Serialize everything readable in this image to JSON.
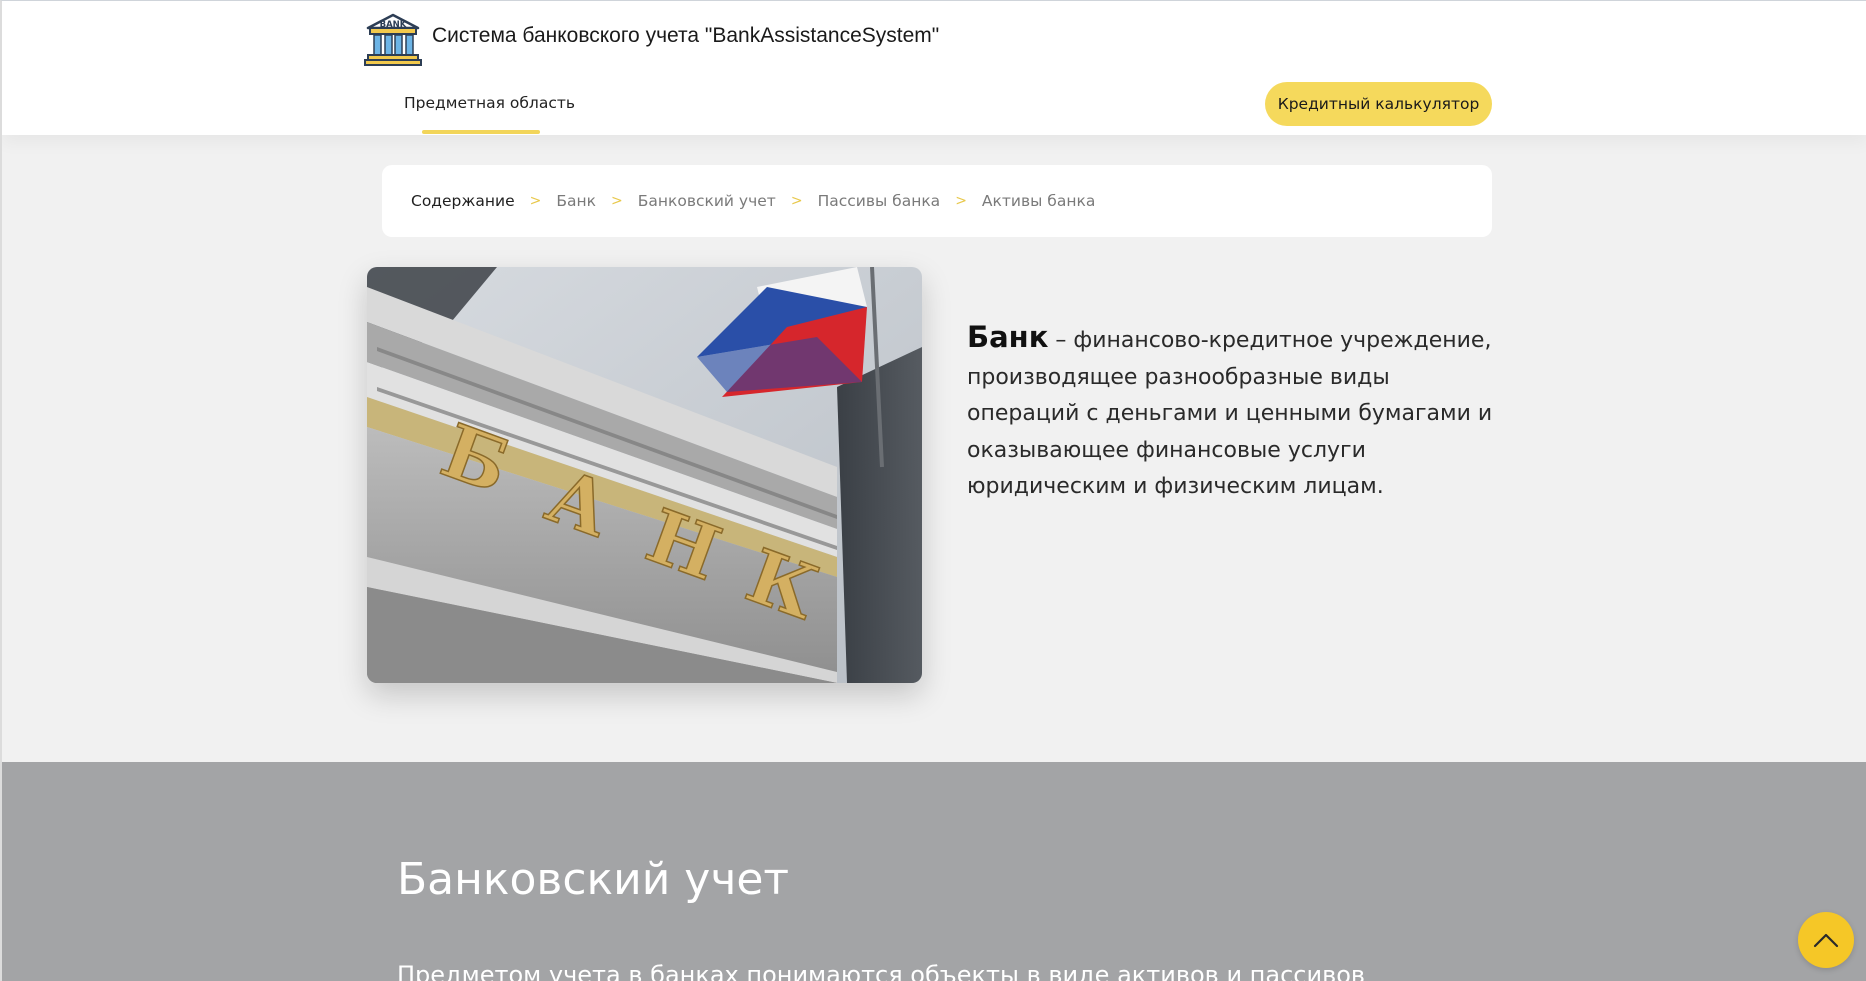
{
  "header": {
    "logo_text": "BANK",
    "site_title": "Система банковского учета \"BankAssistanceSystem\"",
    "nav_link": "Предметная область",
    "calc_button": "Кредитный калькулятор"
  },
  "breadcrumb": {
    "items": [
      "Содержание",
      "Банк",
      "Банковский учет",
      "Пассивы банка",
      "Активы банка"
    ],
    "separator": ">"
  },
  "intro": {
    "image_text": "БАНК",
    "term": "Банк",
    "definition": " – финансово-кредитное учреждение, производящее разнообразные виды операций с деньгами и ценными бумагами и оказывающее финансовые услуги юридическим и физическим лицам."
  },
  "section": {
    "heading": "Банковский учет",
    "text": "Предметом учета в банках понимаются объекты в виде активов и пассивов"
  },
  "icons": {
    "logo": "bank-building-icon",
    "scroll_top": "chevron-up-icon"
  },
  "colors": {
    "accent": "#f5d95c",
    "scroll_button": "#f5c727",
    "gray_section": "#a3a4a6",
    "page_background": "#f1f1f1"
  }
}
